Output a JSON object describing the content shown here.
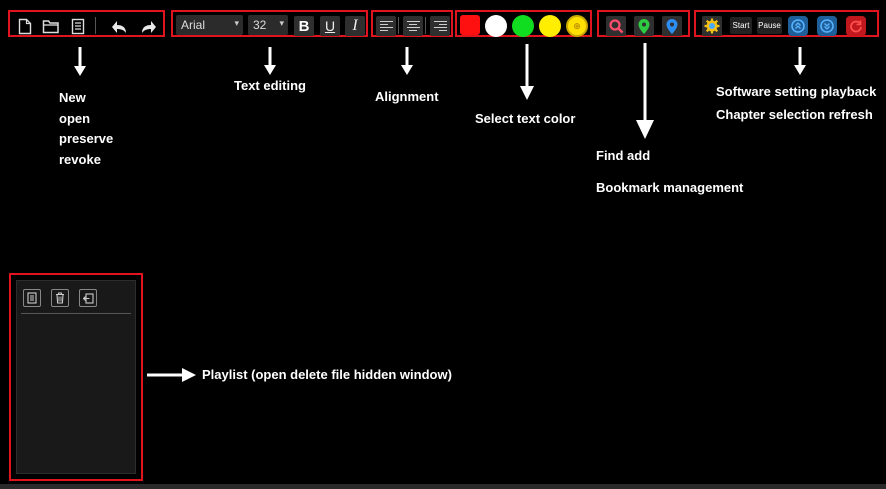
{
  "toolbar": {
    "file": {
      "icons": [
        "new-file-icon",
        "open-folder-icon",
        "save-file-icon",
        "undo-icon",
        "redo-icon"
      ]
    },
    "text": {
      "font": "Arial",
      "size": "32",
      "bold": "B",
      "underline": "U",
      "italic": "I"
    },
    "alignment": {
      "icons": [
        "align-left-icon",
        "align-center-icon",
        "align-right-icon"
      ]
    },
    "colors": {
      "swatches": [
        "#ff1010",
        "#ffffff",
        "#10dd20",
        "#ffee00",
        "#ffe000"
      ]
    },
    "bookmarks": {
      "icons": [
        "find-icon",
        "add-bookmark-icon",
        "bookmark-manage-icon"
      ]
    },
    "playback": {
      "start": "Start",
      "pause": "Pause",
      "icons": [
        "settings-icon",
        "chapter-prev-icon",
        "chapter-next-icon",
        "refresh-icon"
      ]
    }
  },
  "annotations": {
    "file_1": "New",
    "file_2": "open",
    "file_3": "preserve",
    "file_4": "revoke",
    "text_editing": "Text editing",
    "alignment": "Alignment",
    "select_color": "Select text color",
    "find_add": "Find add",
    "bookmark_management": "Bookmark management",
    "software_1": "Software setting playback",
    "software_2": "Chapter selection refresh",
    "playlist": "Playlist (open delete file hidden window)"
  },
  "playlist": {
    "icons": [
      "document-icon",
      "trash-icon",
      "hide-window-icon"
    ]
  }
}
